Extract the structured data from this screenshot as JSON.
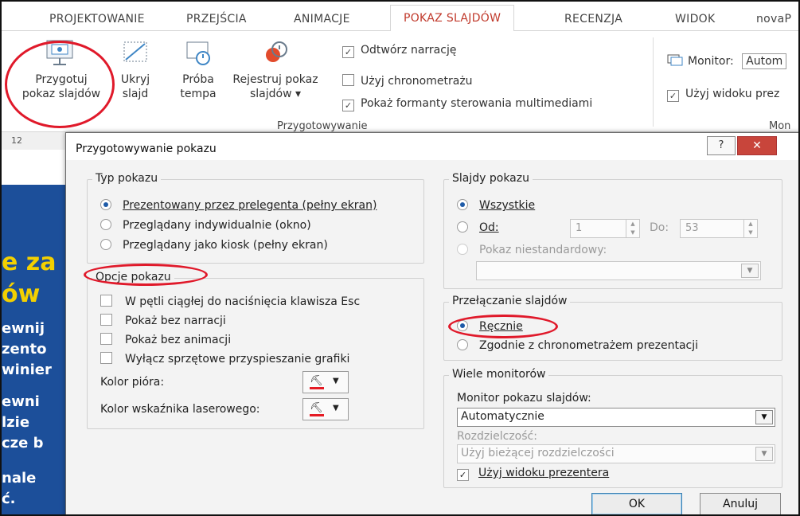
{
  "ribbon_tabs": [
    "PROJEKTOWANIE",
    "PRZEJŚCIA",
    "ANIMACJE",
    "POKAZ SLAJDÓW",
    "RECENZJA",
    "WIDOK",
    "novaP"
  ],
  "ribbon": {
    "setup_line1": "Przygotuj",
    "setup_line2": "pokaz slajdów",
    "hide_line1": "Ukryj",
    "hide_line2": "slajd",
    "rehearse_line1": "Próba",
    "rehearse_line2": "tempa",
    "record_line1": "Rejestruj pokaz",
    "record_line2": "slajdów ▾",
    "cb_narration": "Odtwórz narrację",
    "cb_timings": "Użyj chronometrażu",
    "cb_media": "Pokaż formanty sterowania multimediami",
    "group_label": "Przygotowywanie",
    "monitor_label": "Monitor:",
    "monitor_value": "Autom",
    "presenter_cb": "Użyj widoku prez",
    "monitors_group": "Mon"
  },
  "ruler_text": "12",
  "slide_text": [
    "e za",
    "ów",
    "ewnij",
    "zento",
    "winier",
    "ewni",
    "lzie",
    "cze b",
    "nale",
    "ć."
  ],
  "dialog": {
    "title": "Przygotowywanie pokazu",
    "help": "?",
    "close": "✕",
    "show_type": {
      "legend": "Typ pokazu",
      "options": [
        "Prezentowany przez prelegenta (pełny ekran)",
        "Przeglądany indywidualnie (okno)",
        "Przeglądany jako kiosk (pełny ekran)"
      ]
    },
    "show_options": {
      "legend": "Opcje pokazu",
      "loop": "W pętli ciągłej do naciśnięcia klawisza Esc",
      "no_narration": "Pokaż bez narracji",
      "no_animation": "Pokaż bez animacji",
      "disable_hw": "Wyłącz sprzętowe przyspieszanie grafiki",
      "pen_color": "Kolor pióra:",
      "laser_color": "Kolor wskaźnika laserowego:"
    },
    "show_slides": {
      "legend": "Slajdy pokazu",
      "all": "Wszystkie",
      "from": "Od:",
      "from_value": "1",
      "to": "Do:",
      "to_value": "53",
      "custom": "Pokaz niestandardowy:"
    },
    "advance": {
      "legend": "Przełączanie slajdów",
      "manual": "Ręcznie",
      "timings": "Zgodnie z chronometrażem prezentacji"
    },
    "monitors": {
      "legend": "Wiele monitorów",
      "monitor_label": "Monitor pokazu slajdów:",
      "monitor_value": "Automatycznie",
      "resolution_label": "Rozdzielczość:",
      "resolution_value": "Użyj bieżącej rozdzielczości",
      "presenter": "Użyj widoku prezentera"
    },
    "ok": "OK",
    "cancel": "Anuluj"
  },
  "colors": {
    "accent_tab": "#c0392b",
    "highlight": "#e0192a",
    "slide_bg": "#1c4f9a",
    "radio_dot": "#1e5ba8"
  }
}
